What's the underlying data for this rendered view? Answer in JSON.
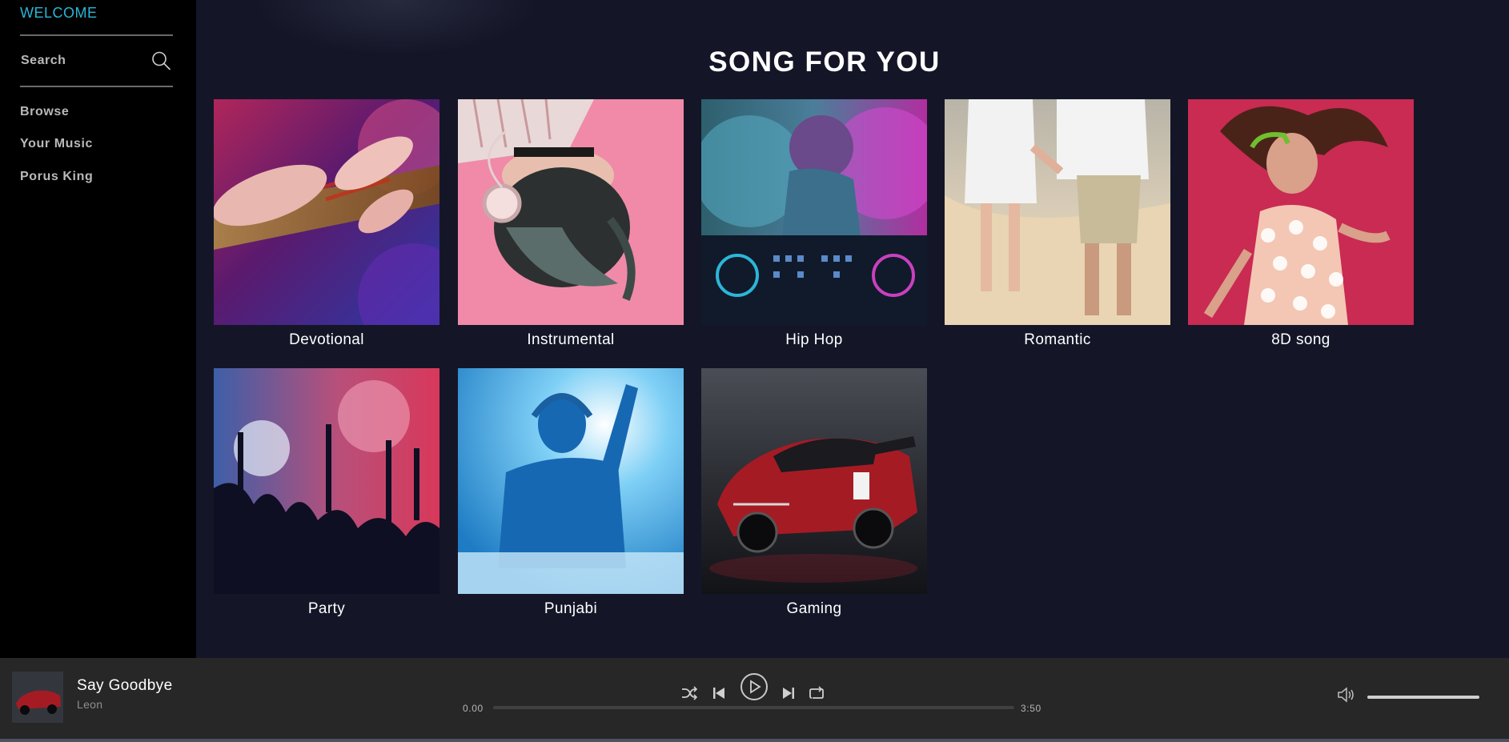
{
  "sidebar": {
    "welcome": "WELCOME",
    "search_label": "Search",
    "nav": [
      "Browse",
      "Your Music",
      "Porus King"
    ]
  },
  "main": {
    "title": "SONG FOR YOU",
    "categories": [
      {
        "label": "Devotional",
        "image": "hands playing bamboo flute"
      },
      {
        "label": "Instrumental",
        "image": "woman with headphones on pink background"
      },
      {
        "label": "Hip Hop",
        "image": "DJ at mixing console with colored smoke"
      },
      {
        "label": "Romantic",
        "image": "couple walking hand in hand on beach"
      },
      {
        "label": "8D song",
        "image": "woman with headphones dancing on red background"
      },
      {
        "label": "Party",
        "image": "crowd with raised hands at concert"
      },
      {
        "label": "Punjabi",
        "image": "silhouette DJ with headphones in blue light"
      },
      {
        "label": "Gaming",
        "image": "red racing car"
      }
    ]
  },
  "player": {
    "song_title": "Say Goodbye",
    "artist": "Leon",
    "current_time": "0.00",
    "duration": "3:50",
    "progress": 0,
    "volume": 1.0,
    "icons": [
      "shuffle-icon",
      "previous-icon",
      "play-icon",
      "next-icon",
      "repeat-icon",
      "volume-icon"
    ]
  },
  "colors": {
    "accent": "#28b6d8",
    "sidebar_bg": "#000000",
    "main_bg": "#141628",
    "player_bg": "#272727"
  }
}
